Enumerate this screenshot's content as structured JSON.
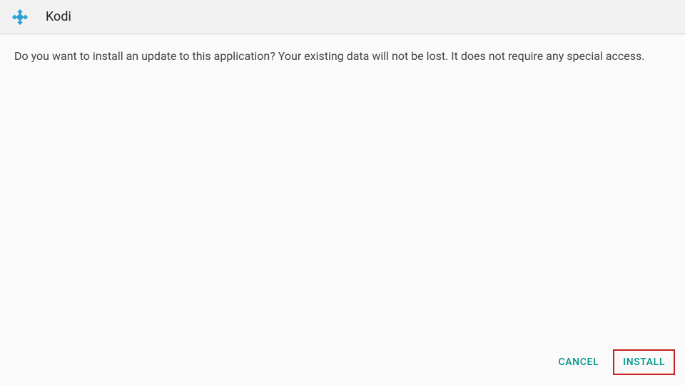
{
  "header": {
    "app_name": "Kodi",
    "icon": "kodi-logo"
  },
  "content": {
    "message": "Do you want to install an update to this application? Your existing data will not be lost. It does not require any special access."
  },
  "actions": {
    "cancel_label": "CANCEL",
    "install_label": "INSTALL"
  },
  "colors": {
    "accent": "#009688",
    "highlight_border": "#c62020"
  }
}
